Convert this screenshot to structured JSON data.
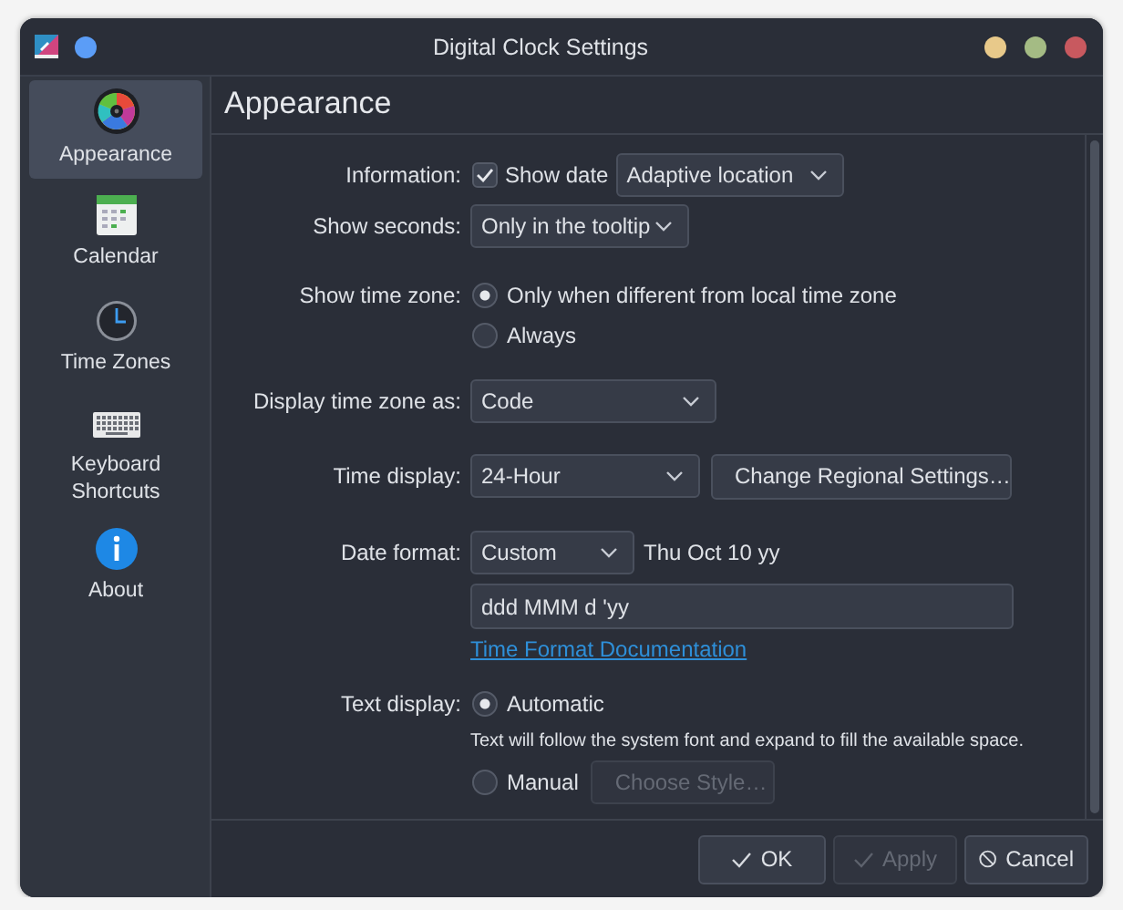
{
  "window": {
    "title": "Digital Clock Settings"
  },
  "sidebar": {
    "items": [
      {
        "kind": "appearance",
        "label": "Appearance",
        "selected": true
      },
      {
        "kind": "calendar",
        "label": "Calendar",
        "selected": false
      },
      {
        "kind": "clock",
        "label": "Time Zones",
        "selected": false
      },
      {
        "kind": "keyboard",
        "label": "Keyboard Shortcuts",
        "selected": false
      },
      {
        "kind": "info",
        "label": "About",
        "selected": false
      }
    ]
  },
  "page_title": "Appearance",
  "information": {
    "label": "Information:",
    "show_date": {
      "label": "Show date",
      "checked": true
    },
    "location": {
      "value": "Adaptive location"
    }
  },
  "show_seconds": {
    "label": "Show seconds:",
    "value": "Only in the tooltip"
  },
  "show_time_zone": {
    "label": "Show time zone:",
    "options": [
      {
        "label": "Only when different from local time zone",
        "selected": true
      },
      {
        "label": "Always",
        "selected": false
      }
    ]
  },
  "display_time_zone_as": {
    "label": "Display time zone as:",
    "value": "Code"
  },
  "time_display": {
    "label": "Time display:",
    "value": "24-Hour",
    "regional_button": "Change Regional Settings…"
  },
  "date_format": {
    "label": "Date format:",
    "value": "Custom",
    "preview": "Thu Oct 10 yy",
    "pattern": "ddd MMM d 'yy",
    "link": "Time Format Documentation"
  },
  "text_display": {
    "label": "Text display:",
    "options": [
      {
        "label": "Automatic",
        "selected": true,
        "note": "Text will follow the system font and expand to fill the available space."
      },
      {
        "label": "Manual",
        "selected": false
      }
    ],
    "style_button": {
      "label": "Choose Style…",
      "disabled": true
    }
  },
  "buttons": [
    {
      "kind": "ok",
      "label": "OK",
      "disabled": false
    },
    {
      "kind": "apply",
      "label": "Apply",
      "disabled": true
    },
    {
      "kind": "cancel",
      "label": "Cancel",
      "disabled": false
    }
  ]
}
